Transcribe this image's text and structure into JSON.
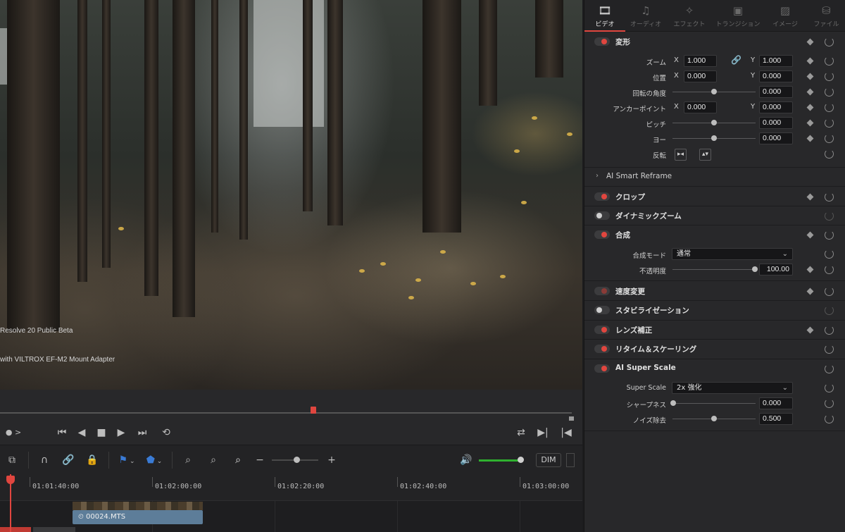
{
  "viewer": {
    "overlay_line1": "Resolve 20 Public Beta",
    "overlay_line2": "with VILTROX EF-M2 Mount Adapter"
  },
  "transport": {
    "left_indicator": "● >"
  },
  "toolbar": {
    "dim_label": "DIM",
    "zoom_minus": "−",
    "zoom_plus": "+"
  },
  "timeline": {
    "timecodes": [
      "01:01:40:00",
      "01:02:00:00",
      "01:02:20:00",
      "01:02:40:00",
      "01:03:00:00"
    ],
    "clip_name": "00024.MTS"
  },
  "inspector": {
    "tabs": [
      {
        "label": "ビデオ",
        "icon": "film-icon",
        "glyph": "🎞"
      },
      {
        "label": "オーディオ",
        "icon": "music-note-icon",
        "glyph": "♫"
      },
      {
        "label": "エフェクト",
        "icon": "magic-wand-icon",
        "glyph": "✧"
      },
      {
        "label": "トランジション",
        "icon": "transition-icon",
        "glyph": "▣"
      },
      {
        "label": "イメージ",
        "icon": "image-icon",
        "glyph": "▨"
      },
      {
        "label": "ファイル",
        "icon": "file-icon",
        "glyph": "⛁"
      }
    ],
    "transform": {
      "title": "変形",
      "zoom_label": "ズーム",
      "zoom_x": "1.000",
      "zoom_y": "1.000",
      "position_label": "位置",
      "position_x": "0.000",
      "position_y": "0.000",
      "rotation_label": "回転の角度",
      "rotation": "0.000",
      "anchor_label": "アンカーポイント",
      "anchor_x": "0.000",
      "anchor_y": "0.000",
      "pitch_label": "ピッチ",
      "pitch": "0.000",
      "yaw_label": "ヨー",
      "yaw": "0.000",
      "flip_label": "反転",
      "x": "X",
      "y": "Y"
    },
    "smart_reframe": {
      "title": "AI Smart Reframe"
    },
    "crop": {
      "title": "クロップ"
    },
    "dynamic_zoom": {
      "title": "ダイナミックズーム"
    },
    "composite": {
      "title": "合成",
      "mode_label": "合成モード",
      "mode_value": "通常",
      "opacity_label": "不透明度",
      "opacity": "100.00"
    },
    "speed": {
      "title": "速度変更"
    },
    "stabilization": {
      "title": "スタビライゼーション"
    },
    "lens": {
      "title": "レンズ補正"
    },
    "retime": {
      "title": "リタイム＆スケーリング"
    },
    "super_scale": {
      "title": "AI Super Scale",
      "scale_label": "Super Scale",
      "scale_value": "2x 強化",
      "sharpness_label": "シャープネス",
      "sharpness": "0.000",
      "noise_label": "ノイズ除去",
      "noise": "0.500"
    }
  }
}
